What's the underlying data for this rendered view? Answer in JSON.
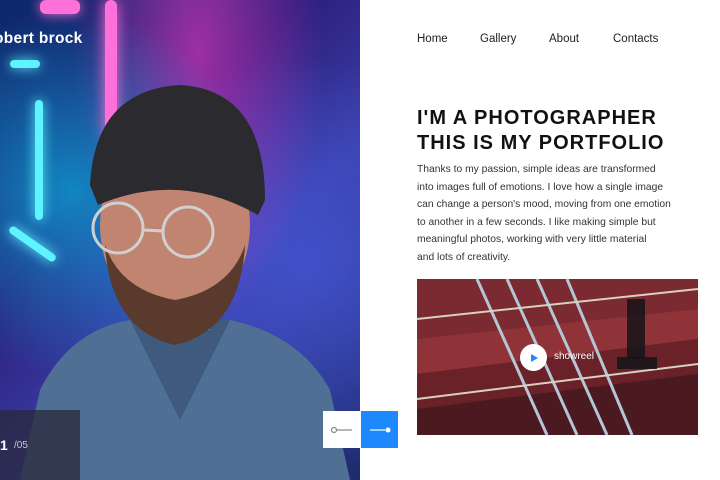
{
  "brand": {
    "name": "obert brock"
  },
  "nav": {
    "items": [
      "Home",
      "Gallery",
      "About",
      "Contacts"
    ]
  },
  "hero": {
    "headline_line1": "I'M A PHOTOGRAPHER",
    "headline_line2": "THIS IS MY PORTFOLIO"
  },
  "bio": {
    "lines": [
      "Thanks to my passion, simple ideas are transformed",
      "into images full of emotions. I love how a single image",
      "can change a person's mood, moving from one emotion",
      "to another in a few seconds. I like making simple but",
      "meaningful photos, working with very little material",
      "and lots of creativity."
    ]
  },
  "video": {
    "label": "showreel"
  },
  "slider": {
    "current": "1",
    "total": "/05"
  },
  "colors": {
    "accent": "#1e88ff",
    "text": "#111111"
  },
  "icons": {
    "prev": "arrow-left-icon",
    "next": "arrow-right-icon",
    "play": "play-icon"
  }
}
